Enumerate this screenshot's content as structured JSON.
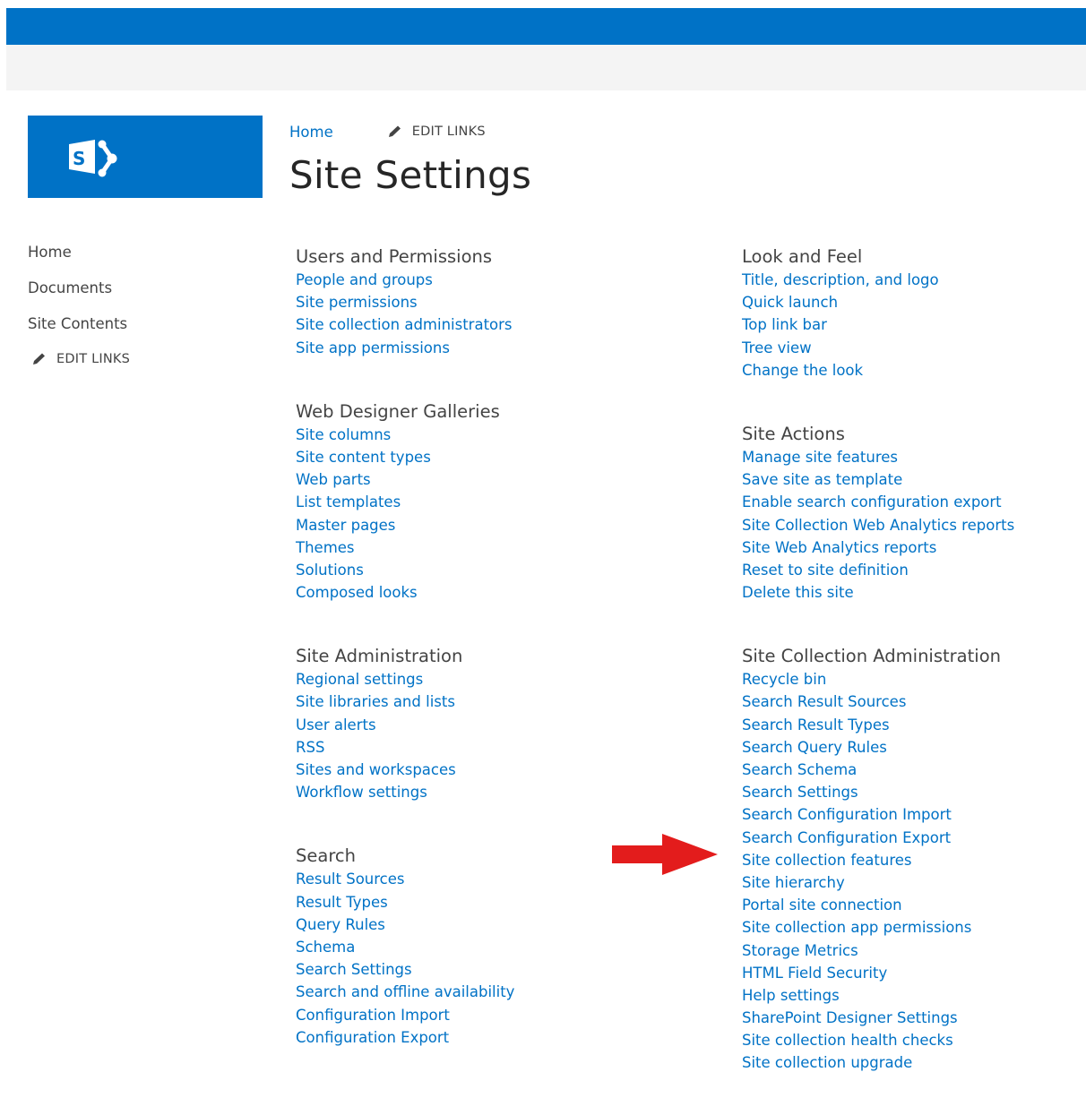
{
  "colors": {
    "suite_bar": "#0072c6",
    "ribbon": "#f4f4f4",
    "link": "#0072c6",
    "annotation_arrow": "#e31c1c"
  },
  "logo": {
    "icon": "sharepoint-logo-icon"
  },
  "breadcrumb": {
    "home": "Home",
    "edit_links": "EDIT LINKS"
  },
  "page_title": "Site Settings",
  "left_nav": {
    "items": [
      {
        "label": "Home"
      },
      {
        "label": "Documents"
      },
      {
        "label": "Site Contents"
      }
    ],
    "edit_links": "EDIT LINKS"
  },
  "sections": {
    "users_permissions": {
      "title": "Users and Permissions",
      "links": [
        "People and groups",
        "Site permissions",
        "Site collection administrators",
        "Site app permissions"
      ]
    },
    "web_designer_galleries": {
      "title": "Web Designer Galleries",
      "links": [
        "Site columns",
        "Site content types",
        "Web parts",
        "List templates",
        "Master pages",
        "Themes",
        "Solutions",
        "Composed looks"
      ]
    },
    "site_administration": {
      "title": "Site Administration",
      "links": [
        "Regional settings",
        "Site libraries and lists",
        "User alerts",
        "RSS",
        "Sites and workspaces",
        "Workflow settings"
      ]
    },
    "search": {
      "title": "Search",
      "links": [
        "Result Sources",
        "Result Types",
        "Query Rules",
        "Schema",
        "Search Settings",
        "Search and offline availability",
        "Configuration Import",
        "Configuration Export"
      ]
    },
    "look_and_feel": {
      "title": "Look and Feel",
      "links": [
        "Title, description, and logo",
        "Quick launch",
        "Top link bar",
        "Tree view",
        "Change the look"
      ]
    },
    "site_actions": {
      "title": "Site Actions",
      "links": [
        "Manage site features",
        "Save site as template",
        "Enable search configuration export",
        "Site Collection Web Analytics reports",
        "Site Web Analytics reports",
        "Reset to site definition",
        "Delete this site"
      ]
    },
    "site_collection_administration": {
      "title": "Site Collection Administration",
      "links": [
        "Recycle bin",
        "Search Result Sources",
        "Search Result Types",
        "Search Query Rules",
        "Search Schema",
        "Search Settings",
        "Search Configuration Import",
        "Search Configuration Export",
        "Site collection features",
        "Site hierarchy",
        "Portal site connection",
        "Site collection app permissions",
        "Storage Metrics",
        "HTML Field Security",
        "Help settings",
        "SharePoint Designer Settings",
        "Site collection health checks",
        "Site collection upgrade"
      ]
    }
  }
}
